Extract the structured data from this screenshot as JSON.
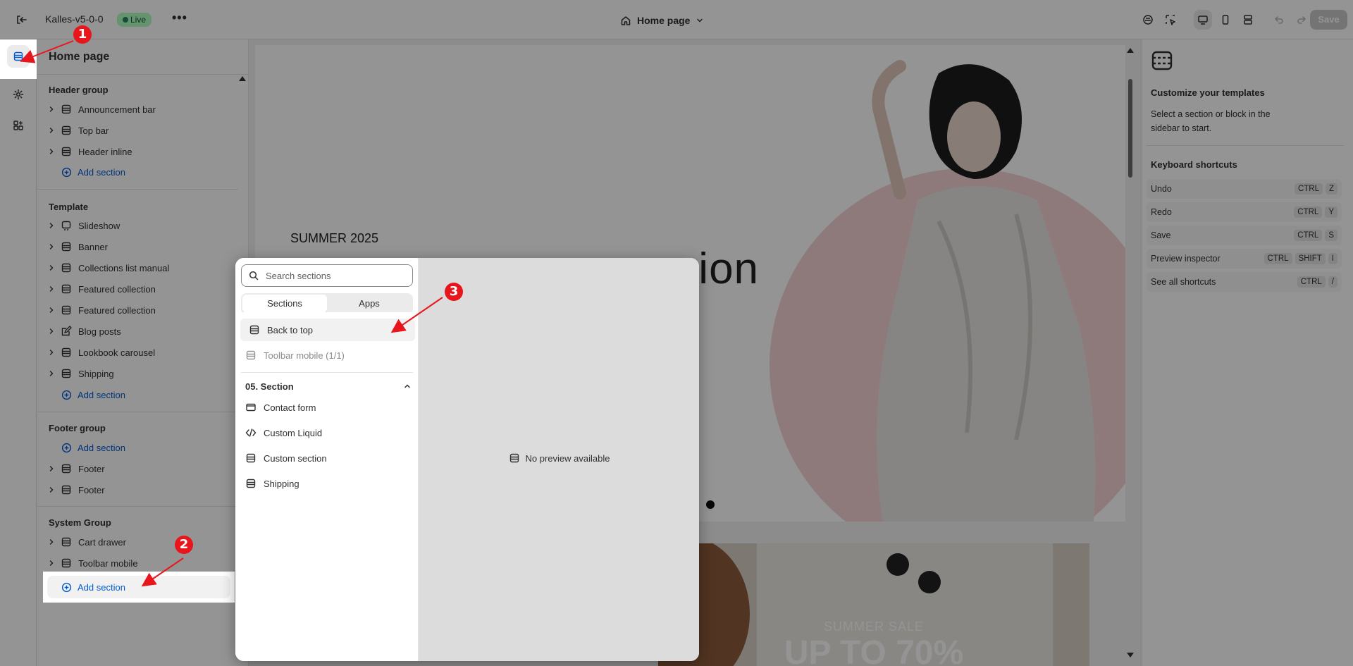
{
  "topbar": {
    "store_name": "Kalles-v5-0-0",
    "status": "Live",
    "page_selector": "Home page",
    "save_label": "Save"
  },
  "sidebar": {
    "title": "Home page",
    "groups": [
      {
        "title": "Header group",
        "items": [
          {
            "label": "Announcement bar",
            "icon": "section-icon"
          },
          {
            "label": "Top bar",
            "icon": "section-icon"
          },
          {
            "label": "Header inline",
            "icon": "section-icon"
          }
        ],
        "add_label": "Add section"
      },
      {
        "title": "Template",
        "items": [
          {
            "label": "Slideshow",
            "icon": "slideshow-icon"
          },
          {
            "label": "Banner",
            "icon": "section-icon"
          },
          {
            "label": "Collections list manual",
            "icon": "section-icon"
          },
          {
            "label": "Featured collection",
            "icon": "section-icon"
          },
          {
            "label": "Featured collection",
            "icon": "section-icon"
          },
          {
            "label": "Blog posts",
            "icon": "blog-icon"
          },
          {
            "label": "Lookbook carousel",
            "icon": "section-icon"
          },
          {
            "label": "Shipping",
            "icon": "section-icon"
          }
        ],
        "add_label": "Add section"
      },
      {
        "title": "Footer group",
        "add_label": "Add section",
        "items": [
          {
            "label": "Footer",
            "icon": "section-icon"
          },
          {
            "label": "Footer",
            "icon": "section-icon"
          }
        ]
      },
      {
        "title": "System Group",
        "items": [
          {
            "label": "Cart drawer",
            "icon": "section-icon"
          },
          {
            "label": "Toolbar mobile",
            "icon": "section-icon"
          }
        ],
        "add_label": "Add section"
      }
    ]
  },
  "preview": {
    "hero_kicker": "SUMMER 2025",
    "hero_headline": "ion",
    "banner_sub": "SUMMER SALE",
    "banner_big": "UP TO 70%"
  },
  "popover": {
    "search_placeholder": "Search sections",
    "tabs": [
      "Sections",
      "Apps"
    ],
    "items_top": [
      {
        "label": "Back to top",
        "disabled": false
      },
      {
        "label": "Toolbar mobile (1/1)",
        "disabled": true
      }
    ],
    "group_title": "05. Section",
    "items_group": [
      {
        "label": "Contact form",
        "icon": "mail-icon"
      },
      {
        "label": "Custom Liquid",
        "icon": "code-icon"
      },
      {
        "label": "Custom section",
        "icon": "section-icon"
      },
      {
        "label": "Shipping",
        "icon": "section-icon"
      }
    ],
    "no_preview": "No preview available"
  },
  "right_panel": {
    "title": "Customize your templates",
    "description": "Select a section or block in the sidebar to start.",
    "shortcuts_title": "Keyboard shortcuts",
    "shortcuts": [
      {
        "label": "Undo",
        "keys": [
          "CTRL",
          "Z"
        ]
      },
      {
        "label": "Redo",
        "keys": [
          "CTRL",
          "Y"
        ]
      },
      {
        "label": "Save",
        "keys": [
          "CTRL",
          "S"
        ]
      },
      {
        "label": "Preview inspector",
        "keys": [
          "CTRL",
          "SHIFT",
          "I"
        ]
      },
      {
        "label": "See all shortcuts",
        "keys": [
          "CTRL",
          "/"
        ]
      }
    ]
  },
  "annotations": [
    "1",
    "2",
    "3"
  ],
  "colors": {
    "accent_blue": "#005bd3",
    "live_green": "#29845a",
    "annotation_red": "#e8161c",
    "hero_circle": "#f4d3d3"
  }
}
